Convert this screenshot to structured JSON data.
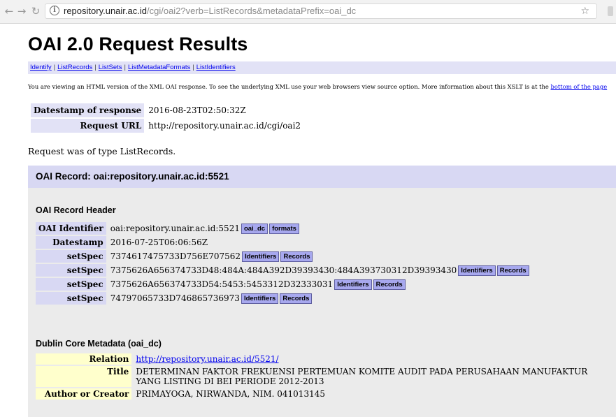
{
  "browser": {
    "url_host": "repository.unair.ac.id",
    "url_path": "/cgi/oai2?verb=ListRecords&metadataPrefix=oai_dc"
  },
  "page": {
    "title": "OAI 2.0 Request Results",
    "quicklinks": [
      "Identify",
      "ListRecords",
      "ListSets",
      "ListMetadataFormats",
      "ListIdentifiers"
    ],
    "separator": "|",
    "intro_text": "You are viewing an HTML version of the XML OAI response. To see the underlying XML use your web browsers view source option. More information about this XSLT is at the ",
    "intro_link": "bottom of the page",
    "response_info": [
      {
        "label": "Datestamp of response",
        "value": "2016-08-23T02:50:32Z"
      },
      {
        "label": "Request URL",
        "value": "http://repository.unair.ac.id/cgi/oai2"
      }
    ],
    "request_type": "Request was of type ListRecords."
  },
  "record": {
    "heading": "OAI Record: oai:repository.unair.ac.id:5521",
    "header_title": "OAI Record Header",
    "identifier_label": "OAI Identifier",
    "identifier_value": "oai:repository.unair.ac.id:5521",
    "identifier_buttons": [
      "oai_dc",
      "formats"
    ],
    "datestamp_label": "Datestamp",
    "datestamp_value": "2016-07-25T06:06:56Z",
    "setspec_label": "setSpec",
    "setspec_buttons": [
      "Identifiers",
      "Records"
    ],
    "setspecs": [
      "7374617475733D756E707562",
      "7375626A656374733D48:484A:484A392D39393430:484A393730312D39393430",
      "7375626A656374733D54:5453:5453312D32333031",
      "74797065733D746865736973"
    ],
    "dc_title": "Dublin Core Metadata (oai_dc)",
    "dc": {
      "relation_label": "Relation",
      "relation_value": "http://repository.unair.ac.id/5521/",
      "title_label": "Title",
      "title_value": "DETERMINAN FAKTOR FREKUENSI PERTEMUAN KOMITE AUDIT PADA PERUSAHAAN MANUFAKTUR YANG LISTING DI BEI PERIODE 2012-2013",
      "creator_label": "Author or Creator",
      "creator_value": "PRIMAYOGA, NIRWANDA, NIM. 041013145"
    }
  }
}
